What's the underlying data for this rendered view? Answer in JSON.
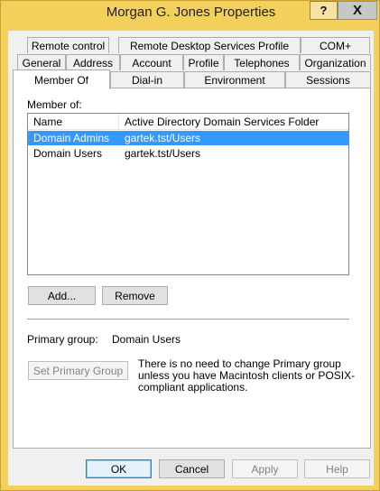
{
  "window": {
    "title": "Morgan G. Jones Properties",
    "help_label": "?",
    "close_label": "X"
  },
  "tabs": {
    "row1": [
      "Remote control",
      "Remote Desktop Services Profile",
      "COM+"
    ],
    "row2": [
      "General",
      "Address",
      "Account",
      "Profile",
      "Telephones",
      "Organization"
    ],
    "row3": [
      "Member Of",
      "Dial-in",
      "Environment",
      "Sessions"
    ],
    "active": "Member Of"
  },
  "member_of": {
    "label": "Member of:",
    "columns": [
      "Name",
      "Active Directory Domain Services Folder"
    ],
    "rows": [
      {
        "name": "Domain Admins",
        "folder": "gartek.tst/Users",
        "selected": true
      },
      {
        "name": "Domain Users",
        "folder": "gartek.tst/Users",
        "selected": false
      }
    ],
    "add_label": "Add...",
    "remove_label": "Remove"
  },
  "primary_group": {
    "label": "Primary group:",
    "value": "Domain Users",
    "set_button_label": "Set Primary Group",
    "note": "There is no need to change Primary group unless you have Macintosh clients or POSIX-compliant applications."
  },
  "footer": {
    "ok_label": "OK",
    "cancel_label": "Cancel",
    "apply_label": "Apply",
    "help_label": "Help"
  },
  "colors": {
    "title_bar": "#f3cf5c",
    "selection": "#3399ff",
    "dialog_background": "#f0f0f0"
  }
}
